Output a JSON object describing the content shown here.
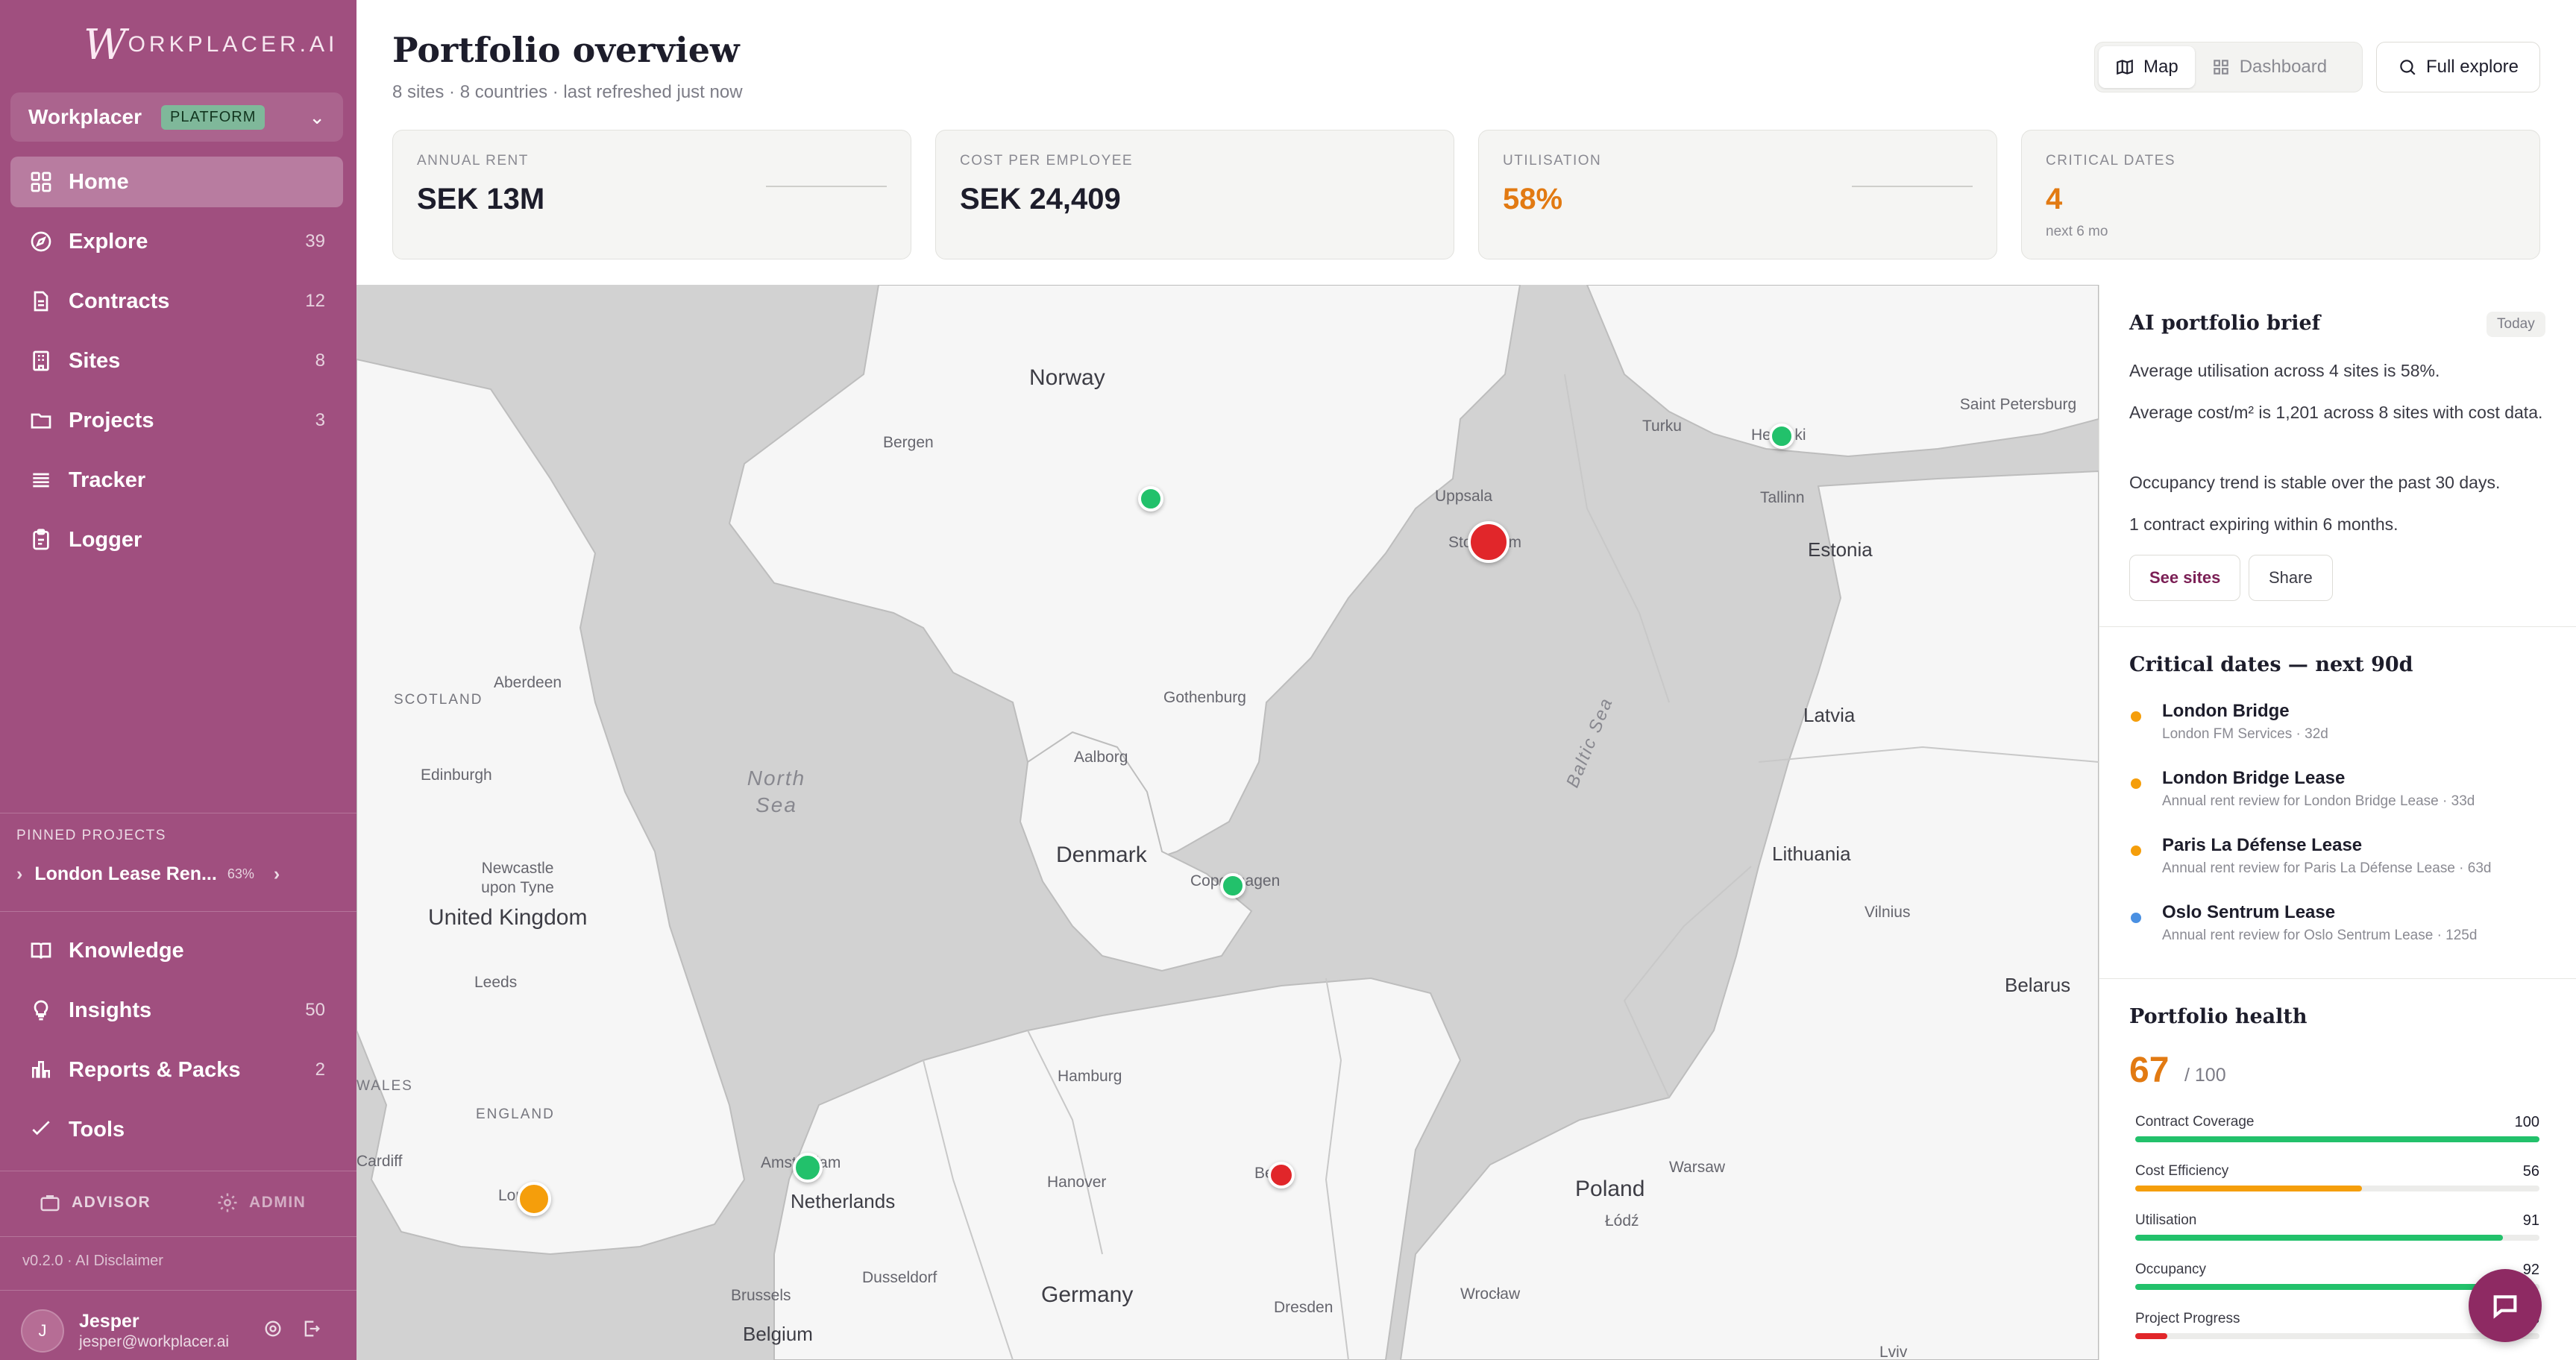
{
  "brand": {
    "logo_initial": "W",
    "logo_rest": "ORKPLACER.AI"
  },
  "org": {
    "name": "Workplacer",
    "badge": "PLATFORM"
  },
  "nav": [
    {
      "label": "Home",
      "count": "",
      "icon": "home-grid-icon"
    },
    {
      "label": "Explore",
      "count": "39",
      "icon": "compass-icon"
    },
    {
      "label": "Contracts",
      "count": "12",
      "icon": "document-icon"
    },
    {
      "label": "Sites",
      "count": "8",
      "icon": "building-icon"
    },
    {
      "label": "Projects",
      "count": "3",
      "icon": "folder-icon"
    },
    {
      "label": "Tracker",
      "count": "",
      "icon": "list-icon"
    },
    {
      "label": "Logger",
      "count": "",
      "icon": "clipboard-icon"
    }
  ],
  "pinned": {
    "title": "PINNED PROJECTS",
    "item": "London Lease Ren...",
    "pct": "63%"
  },
  "nav2": [
    {
      "label": "Knowledge",
      "count": "",
      "icon": "book-icon"
    },
    {
      "label": "Insights",
      "count": "50",
      "icon": "bulb-icon"
    },
    {
      "label": "Reports & Packs",
      "count": "2",
      "icon": "bar-chart-icon"
    },
    {
      "label": "Tools",
      "count": "",
      "icon": "wrench-icon"
    }
  ],
  "roles": {
    "advisor": "ADVISOR",
    "admin": "ADMIN"
  },
  "footer": {
    "version": "v0.2.0 · AI Disclaimer"
  },
  "user": {
    "initial": "J",
    "name": "Jesper",
    "email": "jesper@workplacer.ai"
  },
  "header": {
    "title": "Portfolio overview",
    "subtitle": "8 sites · 8 countries · last refreshed just now",
    "view_map": "Map",
    "view_dashboard": "Dashboard",
    "full_explore": "Full explore"
  },
  "kpis": [
    {
      "label": "ANNUAL RENT",
      "value": "SEK 13M",
      "note": ""
    },
    {
      "label": "COST PER EMPLOYEE",
      "value": "SEK 24,409",
      "note": ""
    },
    {
      "label": "UTILISATION",
      "value": "58%",
      "note": ""
    },
    {
      "label": "CRITICAL DATES",
      "value": "4",
      "note": "next 6 mo"
    }
  ],
  "map": {
    "countries": [
      "Norway",
      "Denmark",
      "United Kingdom",
      "Netherlands",
      "Germany",
      "Poland",
      "Belgium",
      "Estonia",
      "Latvia",
      "Lithuania",
      "Belarus"
    ],
    "cities": [
      "Bergen",
      "Uppsala",
      "Stockholm",
      "Turku",
      "Helsinki",
      "Saint Petersburg",
      "Tallinn",
      "Aberdeen",
      "Edinburgh",
      "Gothenburg",
      "Aalborg",
      "Newcastle upon Tyne",
      "Leeds",
      "Copenhagen",
      "Hamburg",
      "Hanover",
      "Berlin",
      "Warsaw",
      "Łódź",
      "Amsterdam",
      "London",
      "Cardiff",
      "Dusseldorf",
      "Brussels",
      "Dresden",
      "Wrocław",
      "Vilnius",
      "Lviv"
    ],
    "regions": [
      "SCOTLAND",
      "ENGLAND",
      "WALES"
    ],
    "seas": [
      "North Sea",
      "Baltic Sea"
    ],
    "markers": [
      {
        "site": "Oslo",
        "status": "green"
      },
      {
        "site": "Stockholm",
        "status": "red"
      },
      {
        "site": "Helsinki",
        "status": "green"
      },
      {
        "site": "Copenhagen",
        "status": "green"
      },
      {
        "site": "Amsterdam",
        "status": "green"
      },
      {
        "site": "Berlin",
        "status": "red"
      },
      {
        "site": "London",
        "status": "orange"
      }
    ],
    "status_colors": {
      "green": "#22c16b",
      "red": "#e1262a",
      "orange": "#f59e0b"
    }
  },
  "brief": {
    "title": "AI portfolio brief",
    "badge": "Today",
    "lines": [
      "Average utilisation across 4 sites is 58%.",
      "Average cost/m² is 1,201 across 8 sites with cost data.",
      "Occupancy trend is stable over the past 30 days.",
      "1 contract expiring within 6 months."
    ],
    "see_sites": "See sites",
    "share": "Share"
  },
  "critical": {
    "title": "Critical dates — next 90d",
    "items": [
      {
        "name": "London Bridge",
        "sub": "London FM Services · 32d",
        "color": "#f59e0b"
      },
      {
        "name": "London Bridge Lease",
        "sub": "Annual rent review for London Bridge Lease · 33d",
        "color": "#f59e0b"
      },
      {
        "name": "Paris La Défense Lease",
        "sub": "Annual rent review for Paris La Défense Lease · 63d",
        "color": "#f59e0b"
      },
      {
        "name": "Oslo Sentrum Lease",
        "sub": "Annual rent review for Oslo Sentrum Lease · 125d",
        "color": "#4a90e2"
      }
    ]
  },
  "health": {
    "title": "Portfolio health",
    "score": "67",
    "of": "/ 100",
    "metrics": [
      {
        "name": "Contract Coverage",
        "value": "100",
        "pct": 100,
        "color": "#22c16b"
      },
      {
        "name": "Cost Efficiency",
        "value": "56",
        "pct": 56,
        "color": "#f59e0b"
      },
      {
        "name": "Utilisation",
        "value": "91",
        "pct": 91,
        "color": "#22c16b"
      },
      {
        "name": "Occupancy",
        "value": "92",
        "pct": 92,
        "color": "#22c16b"
      },
      {
        "name": "Project Progress",
        "value": "8",
        "pct": 8,
        "color": "#e1262a"
      }
    ]
  }
}
